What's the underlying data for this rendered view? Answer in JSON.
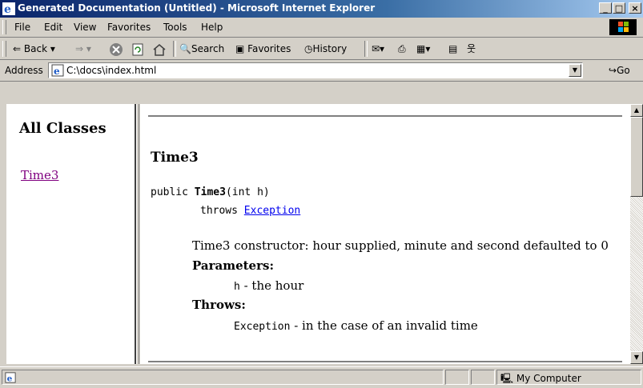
{
  "window": {
    "title": "Generated Documentation (Untitled) - Microsoft Internet Explorer"
  },
  "menu": [
    "File",
    "Edit",
    "View",
    "Favorites",
    "Tools",
    "Help"
  ],
  "toolbar": {
    "back": "Back",
    "search": "Search",
    "favorites": "Favorites",
    "history": "History"
  },
  "address": {
    "label": "Address",
    "value": "C:\\docs\\index.html",
    "go": "Go"
  },
  "left_frame": {
    "heading": "All Classes",
    "class_link": "Time3"
  },
  "doc": {
    "title": "Time3",
    "sig_prefix": "public ",
    "sig_name": "Time3",
    "sig_args": "(int h)",
    "throws_kw": "throws ",
    "throws_link": "Exception",
    "description": "Time3 constructor: hour supplied, minute and second defaulted to 0",
    "params_label": "Parameters:",
    "param_name": "h",
    "param_desc": " - the hour",
    "throws_label": "Throws:",
    "exc_name": "Exception",
    "exc_desc": " - in the case of an invalid time"
  },
  "status": {
    "zone": "My Computer"
  },
  "colors": {
    "titlebar": "#0a246a",
    "visited_link": "#800080",
    "link": "#0000ee",
    "chrome": "#d4d0c8"
  }
}
